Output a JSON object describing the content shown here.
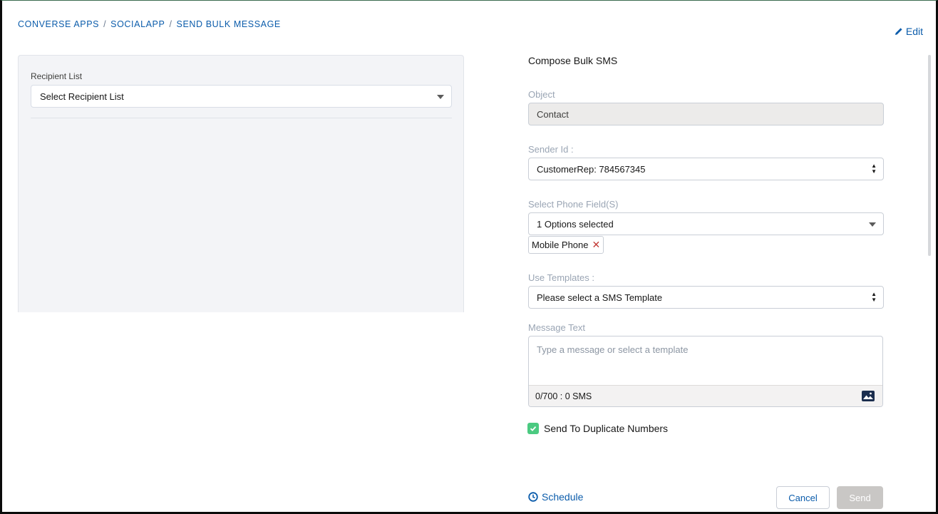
{
  "breadcrumb": {
    "items": [
      "CONVERSE APPS",
      "SOCIALAPP",
      "SEND BULK MESSAGE"
    ],
    "separator": "/"
  },
  "header": {
    "edit_label": "Edit",
    "edit_icon": "pencil-icon"
  },
  "left_panel": {
    "recipient_label": "Recipient List",
    "recipient_value": "Select Recipient List"
  },
  "compose": {
    "title": "Compose Bulk SMS",
    "object_label": "Object",
    "object_value": "Contact",
    "sender_label": "Sender Id :",
    "sender_value": "CustomerRep: 784567345",
    "phone_label": "Select Phone Field(S)",
    "phone_value": "1 Options selected",
    "phone_pill": "Mobile Phone",
    "templates_label": "Use Templates :",
    "templates_value": "Please select a SMS Template",
    "message_label": "Message Text",
    "message_placeholder": "Type a message or select a template",
    "message_counter": "0/700 : 0 SMS",
    "duplicate_label": "Send To Duplicate Numbers",
    "duplicate_checked": true
  },
  "actions": {
    "schedule_label": "Schedule",
    "cancel_label": "Cancel",
    "send_label": "Send"
  },
  "colors": {
    "link": "#0b5cab",
    "checkbox": "#4bca81",
    "send_disabled": "#c9c7c5"
  }
}
